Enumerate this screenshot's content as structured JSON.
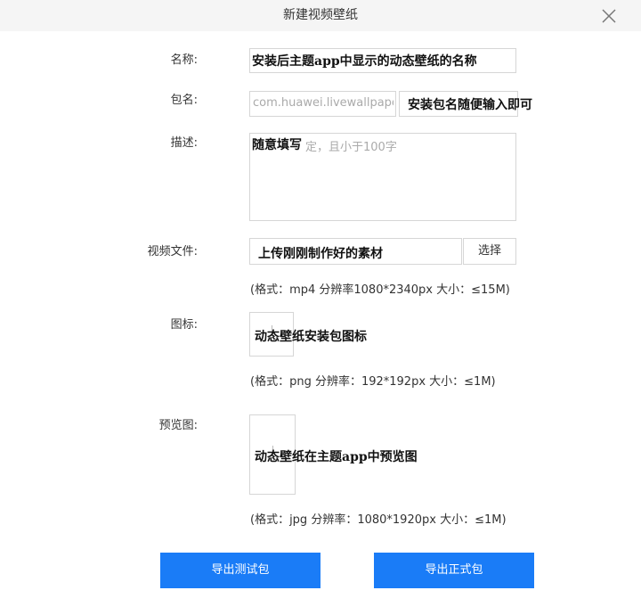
{
  "dialog": {
    "title": "新建视频壁纸",
    "close_icon": "close-icon"
  },
  "form": {
    "name": {
      "label": "名称:",
      "value": "安装后主题app中显示的动态壁纸的名称"
    },
    "package": {
      "label": "包名:",
      "placeholder": "com.huawei.livewallpaper.",
      "annotation": "安装包名随便输入即可"
    },
    "description": {
      "label": "描述:",
      "placeholder": "定，且小于100字",
      "value": "随意填写"
    },
    "video": {
      "label": "视频文件:",
      "value": "上传刚刚制作好的素材",
      "choose_label": "选择",
      "hint": "(格式：mp4 分辨率1080*2340px 大小：≤15M)"
    },
    "icon": {
      "label": "图标:",
      "annotation": "动态壁纸安装包图标",
      "hint": "(格式：png 分辨率：192*192px 大小：≤1M)"
    },
    "preview": {
      "label": "预览图:",
      "annotation": "动态壁纸在主题app中预览图",
      "hint": "(格式：jpg 分辨率：1080*1920px 大小：≤1M)"
    }
  },
  "actions": {
    "export_test": "导出测试包",
    "export_release": "导出正式包"
  },
  "colors": {
    "primary": "#1a7cf7",
    "border": "#d6d6d6",
    "titlebar": "#f5f5f5"
  }
}
